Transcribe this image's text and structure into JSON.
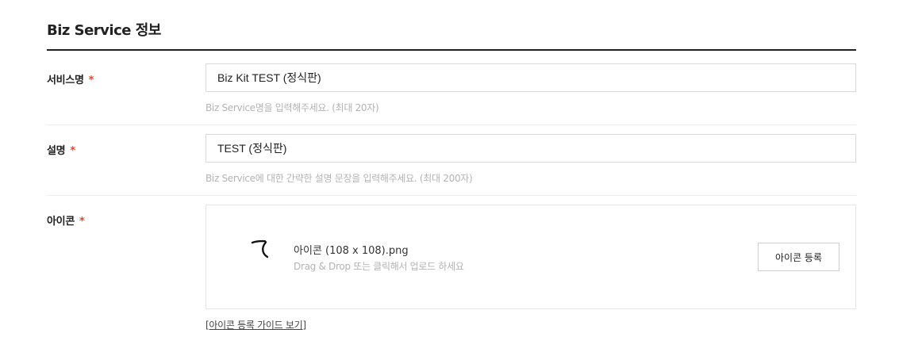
{
  "section": {
    "title": "Biz Service 정보"
  },
  "form": {
    "required_mark": "*",
    "service_name": {
      "label": "서비스명",
      "value": "Biz Kit TEST (정식판)",
      "hint": "Biz Service명을 입력해주세요. (최대 20자)"
    },
    "description": {
      "label": "설명",
      "value": "TEST (정식판)",
      "hint": "Biz Service에 대한 간략한 설명 문장을 입력해주세요. (최대 200자)"
    },
    "icon": {
      "label": "아이콘",
      "file_name": "아이콘 (108 x 108).png",
      "dropzone_hint": "Drag & Drop 또는 클릭해서 업로드 하세요",
      "upload_button": "아이콘 등록",
      "guide_link": "[아이콘 등록 가이드 보기]"
    }
  },
  "icons": {
    "preview": "icon-preview-image"
  }
}
